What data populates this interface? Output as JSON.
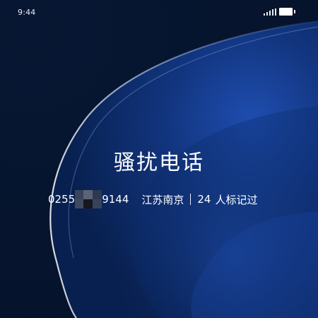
{
  "status_bar": {
    "time": "9:44",
    "signal_icon": "signal-icon",
    "battery_icon": "battery-icon"
  },
  "call": {
    "title": "骚扰电话",
    "number_prefix": "0255",
    "number_suffix": "9144",
    "number_masked": true,
    "location": "江苏南京",
    "separator": "|",
    "mark_count": "24",
    "mark_text": "人标记过"
  },
  "colors": {
    "background_dark": "#06142d",
    "accent_blue": "#1e4aa8",
    "text": "#ffffff"
  }
}
